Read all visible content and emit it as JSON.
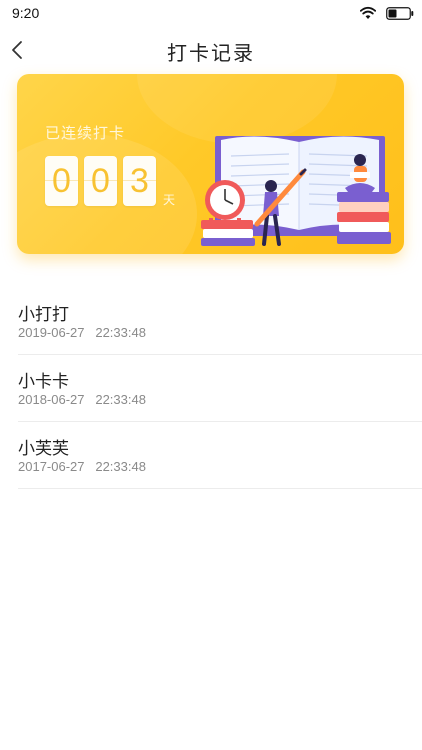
{
  "status_bar": {
    "time": "9:20",
    "wifi_icon": "wifi-icon",
    "battery_icon": "battery-icon"
  },
  "nav": {
    "back_icon": "chevron-left-icon",
    "title": "打卡记录"
  },
  "banner": {
    "label": "已连续打卡",
    "digits": [
      "0",
      "0",
      "3"
    ],
    "unit": "天",
    "illustration_icon": "reading-illustration",
    "colors": {
      "background": "#ffc928",
      "digit": "#f8c232"
    }
  },
  "records": [
    {
      "name": "小打打",
      "time": "2019-06-27   22:33:48"
    },
    {
      "name": "小卡卡",
      "time": "2018-06-27   22:33:48"
    },
    {
      "name": "小芙芙",
      "time": "2017-06-27   22:33:48"
    }
  ]
}
